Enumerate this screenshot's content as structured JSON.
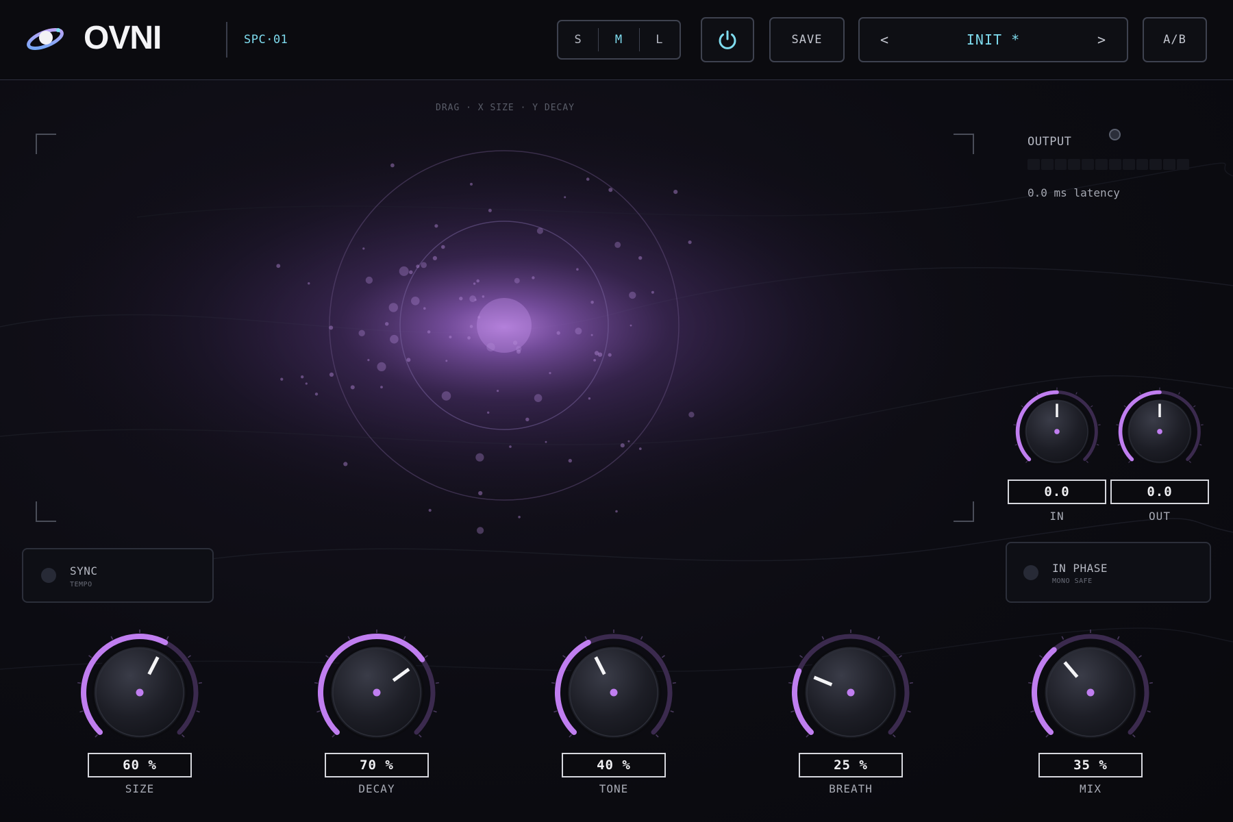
{
  "header": {
    "brand": "OVNI",
    "model": "SPC·01",
    "size_options": [
      {
        "label": "S",
        "active": false
      },
      {
        "label": "M",
        "active": true
      },
      {
        "label": "L",
        "active": false
      }
    ],
    "save_label": "SAVE",
    "preset": {
      "prev": "<",
      "name": "INIT *",
      "next": ">"
    },
    "ab_label": "A/B"
  },
  "display": {
    "hint": "DRAG · X SIZE · Y DECAY"
  },
  "output": {
    "label": "OUTPUT",
    "latency": "0.0 ms latency",
    "meter_level": 0
  },
  "io_knobs": [
    {
      "id": "in",
      "label": "IN",
      "value_text": "0.0",
      "fraction": 0.5
    },
    {
      "id": "out",
      "label": "OUT",
      "value_text": "0.0",
      "fraction": 0.5
    }
  ],
  "toggles": {
    "sync": {
      "label": "SYNC",
      "sub": "TEMPO",
      "on": false
    },
    "phase": {
      "label": "IN PHASE",
      "sub": "MONO SAFE",
      "on": false
    }
  },
  "main_knobs": [
    {
      "id": "size",
      "label": "SIZE",
      "value_text": "60 %",
      "fraction": 0.6
    },
    {
      "id": "decay",
      "label": "DECAY",
      "value_text": "70 %",
      "fraction": 0.7
    },
    {
      "id": "tone",
      "label": "TONE",
      "value_text": "40 %",
      "fraction": 0.4
    },
    {
      "id": "breath",
      "label": "BREATH",
      "value_text": "25 %",
      "fraction": 0.25
    },
    {
      "id": "mix",
      "label": "MIX",
      "value_text": "35 %",
      "fraction": 0.35
    }
  ],
  "colors": {
    "accent": "#c07ef0",
    "cyan": "#7fdcef",
    "track": "#3b2a4e",
    "background": "#0b0b10"
  },
  "icons": {
    "logo": "ufo-ring-icon",
    "power": "power-icon"
  }
}
